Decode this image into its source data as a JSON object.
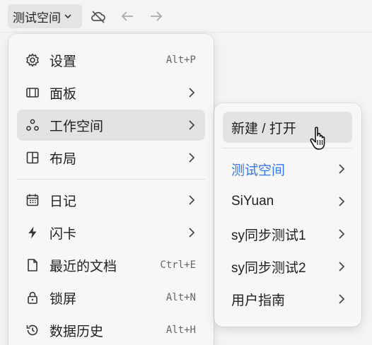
{
  "toolbar": {
    "workspace_label": "测试空间",
    "icons": [
      "chevron-down-icon",
      "cloud-off-icon",
      "back-arrow-icon",
      "forward-arrow-icon"
    ]
  },
  "menu": {
    "items": [
      {
        "label": "设置",
        "shortcut": "Alt+P",
        "icon": "gear-icon"
      },
      {
        "label": "面板",
        "icon": "panel-icon",
        "submenu": true
      },
      {
        "label": "工作空间",
        "icon": "workspace-icon",
        "submenu": true,
        "active": true
      },
      {
        "label": "布局",
        "icon": "layout-icon",
        "submenu": true
      },
      {
        "label": "日记",
        "icon": "calendar-icon",
        "submenu": true
      },
      {
        "label": "闪卡",
        "icon": "lightning-icon",
        "submenu": true
      },
      {
        "label": "最近的文档",
        "shortcut": "Ctrl+E",
        "icon": "file-icon"
      },
      {
        "label": "锁屏",
        "shortcut": "Alt+N",
        "icon": "lock-icon"
      },
      {
        "label": "数据历史",
        "shortcut": "Alt+H",
        "icon": "history-icon"
      }
    ]
  },
  "submenu": {
    "items": [
      {
        "label": "新建 / 打开",
        "hover": true
      },
      {
        "label": "测试空间",
        "current": true,
        "submenu": true
      },
      {
        "label": "SiYuan",
        "submenu": true
      },
      {
        "label": "sy同步测试1",
        "submenu": true
      },
      {
        "label": "sy同步测试2",
        "submenu": true
      },
      {
        "label": "用户指南",
        "submenu": true
      }
    ]
  },
  "colors": {
    "accent": "#3575f0",
    "hover": "#e3e3e3",
    "menu_bg": "#f7f7f7"
  }
}
